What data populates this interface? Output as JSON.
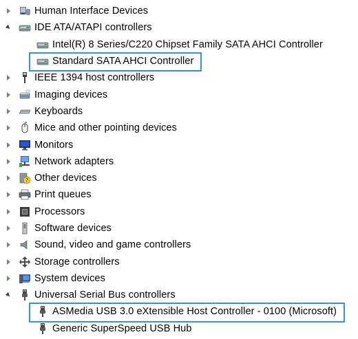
{
  "tree": [
    {
      "label": "Human Interface Devices",
      "icon": "hid-icon",
      "expanded": false
    },
    {
      "label": "IDE ATA/ATAPI controllers",
      "icon": "ide-controller-icon",
      "expanded": true,
      "children": [
        {
          "label": "Intel(R) 8 Series/C220 Chipset Family SATA AHCI Controller",
          "icon": "ide-controller-icon"
        },
        {
          "label": "Standard SATA AHCI Controller",
          "icon": "ide-controller-icon",
          "highlighted": true
        }
      ]
    },
    {
      "label": "IEEE 1394 host controllers",
      "icon": "ieee1394-icon",
      "expanded": false
    },
    {
      "label": "Imaging devices",
      "icon": "scanner-icon",
      "expanded": false
    },
    {
      "label": "Keyboards",
      "icon": "keyboard-icon",
      "expanded": false
    },
    {
      "label": "Mice and other pointing devices",
      "icon": "mouse-icon",
      "expanded": false
    },
    {
      "label": "Monitors",
      "icon": "monitor-icon",
      "expanded": false
    },
    {
      "label": "Network adapters",
      "icon": "network-icon",
      "expanded": false
    },
    {
      "label": "Other devices",
      "icon": "unknown-device-icon",
      "expanded": false
    },
    {
      "label": "Print queues",
      "icon": "printer-icon",
      "expanded": false
    },
    {
      "label": "Processors",
      "icon": "processor-icon",
      "expanded": false
    },
    {
      "label": "Software devices",
      "icon": "software-device-icon",
      "expanded": false
    },
    {
      "label": "Sound, video and game controllers",
      "icon": "speaker-icon",
      "expanded": false
    },
    {
      "label": "Storage controllers",
      "icon": "storage-controller-icon",
      "expanded": false
    },
    {
      "label": "System devices",
      "icon": "system-device-icon",
      "expanded": false
    },
    {
      "label": "Universal Serial Bus controllers",
      "icon": "usb-icon",
      "expanded": true,
      "children": [
        {
          "label": "ASMedia USB 3.0 eXtensible Host Controller - 0100 (Microsoft)",
          "icon": "usb-icon",
          "highlighted": true
        },
        {
          "label": "Generic SuperSpeed USB Hub",
          "icon": "usb-icon"
        }
      ]
    }
  ],
  "colors": {
    "highlight_border": "#2f95d4",
    "arrow": "#808080"
  }
}
